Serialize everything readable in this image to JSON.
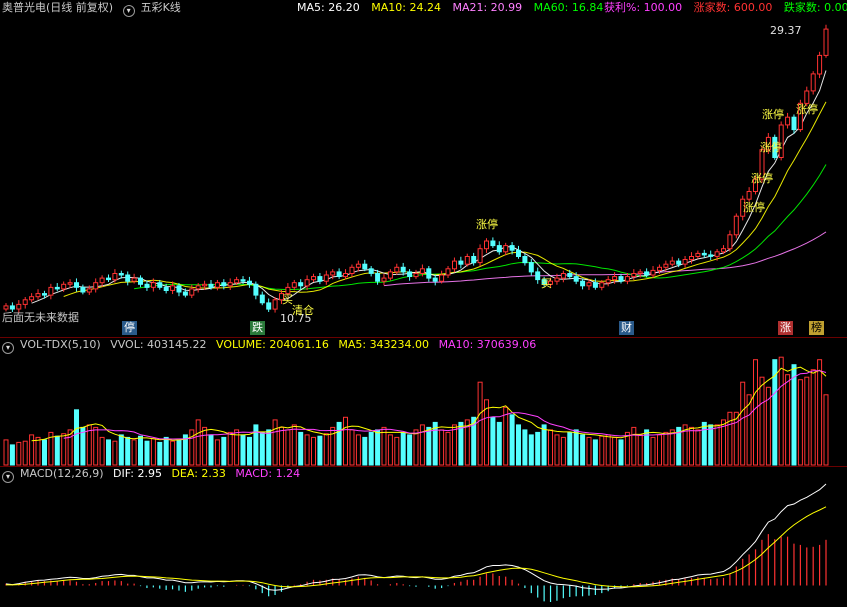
{
  "main_header": {
    "stock_name": "奥普光电",
    "period_info": "(日线 前复权)",
    "indicator_name": "五彩K线",
    "ma5_label": "MA5:",
    "ma5_value": "26.20",
    "ma10_label": "MA10:",
    "ma10_value": "24.24",
    "ma21_label": "MA21:",
    "ma21_value": "20.99",
    "ma60_label": "MA60:",
    "ma60_value": "16.84",
    "profit_label": "获利%:",
    "profit_value": "100.00",
    "up_label": "涨家数:",
    "up_value": "600.00",
    "down_label": "跌家数:",
    "down_value": "0.00"
  },
  "price_labels": {
    "high": "29.37",
    "low": "10.75"
  },
  "no_future_data": "后面无未来数据",
  "annotations": [
    {
      "text": "涨停",
      "color": "#ffff44"
    },
    {
      "text": "涨停",
      "color": "#ffff44"
    },
    {
      "text": "涨停",
      "color": "#ffff44"
    },
    {
      "text": "涨停",
      "color": "#ffff44"
    },
    {
      "text": "涨停",
      "color": "#ffff44"
    },
    {
      "text": "涨停",
      "color": "#ffff44"
    },
    {
      "text": "清仓",
      "color": "#ffff44"
    },
    {
      "text": "买",
      "color": "#ffff44"
    },
    {
      "text": "买",
      "color": "#ffff44"
    }
  ],
  "markers": [
    {
      "label": "停",
      "bg": "#2a5a8a",
      "color": "#ffffff"
    },
    {
      "label": "跌",
      "bg": "#2a7a3a",
      "color": "#ffffff"
    },
    {
      "label": "财",
      "bg": "#2a5a8a",
      "color": "#ffffff"
    },
    {
      "label": "涨",
      "bg": "#b03030",
      "color": "#ffffff"
    },
    {
      "label": "榜",
      "bg": "#c0a030",
      "color": "#000000"
    }
  ],
  "vol_header": {
    "name": "VOL-TDX(5,10)",
    "vvol_label": "VVOL:",
    "vvol_value": "403145.22",
    "volume_label": "VOLUME:",
    "volume_value": "204061.16",
    "ma5_label": "MA5:",
    "ma5_value": "343234.00",
    "ma10_label": "MA10:",
    "ma10_value": "370639.06"
  },
  "macd_header": {
    "name": "MACD(12,26,9)",
    "dif_label": "DIF:",
    "dif_value": "2.95",
    "dea_label": "DEA:",
    "dea_value": "2.33",
    "macd_label": "MACD:",
    "macd_value": "1.24"
  },
  "colors": {
    "up": "#ff3232",
    "down": "#54ffff",
    "ma5": "#ffffff",
    "ma10": "#ffff00",
    "ma21": "#ff80ff",
    "ma60": "#00ff00",
    "grid": "#6a0000",
    "profit": "#ff40ff",
    "up_count": "#ff3232",
    "down_count": "#00ff00"
  },
  "chart_data": {
    "type": "candlestick",
    "price_range": [
      10.75,
      29.37
    ],
    "close": [
      11.4,
      11.2,
      11.5,
      11.8,
      12.0,
      12.2,
      12.1,
      12.6,
      12.5,
      12.8,
      12.9,
      12.6,
      12.3,
      12.5,
      12.9,
      13.2,
      13.1,
      13.5,
      13.4,
      13.0,
      13.2,
      12.8,
      12.6,
      12.9,
      12.6,
      12.4,
      12.7,
      12.3,
      12.1,
      12.5,
      12.7,
      12.8,
      12.6,
      12.9,
      12.7,
      12.9,
      13.1,
      13.0,
      12.8,
      12.1,
      11.6,
      11.2,
      11.8,
      12.2,
      12.6,
      12.9,
      12.7,
      13.1,
      13.3,
      13.0,
      13.4,
      13.6,
      13.3,
      13.5,
      13.9,
      14.1,
      13.8,
      13.5,
      13.0,
      13.2,
      13.6,
      13.9,
      13.6,
      13.3,
      13.5,
      13.8,
      13.2,
      13.0,
      13.4,
      13.8,
      14.3,
      14.1,
      14.6,
      14.2,
      15.1,
      15.6,
      15.3,
      14.9,
      15.3,
      15.0,
      14.6,
      14.2,
      13.6,
      13.1,
      12.8,
      13.0,
      13.2,
      13.5,
      13.3,
      13.0,
      12.7,
      12.9,
      12.6,
      12.9,
      13.1,
      13.3,
      13.0,
      13.3,
      13.5,
      13.6,
      13.4,
      13.7,
      13.9,
      14.1,
      14.3,
      14.1,
      14.4,
      14.6,
      14.8,
      14.7,
      14.6,
      14.9,
      15.1,
      16.0,
      17.2,
      18.3,
      18.8,
      19.6,
      21.5,
      22.3,
      21.0,
      23.1,
      23.6,
      22.8,
      24.5,
      25.3,
      26.4,
      27.6,
      29.3
    ],
    "volume": [
      100,
      80,
      90,
      95,
      120,
      110,
      100,
      130,
      115,
      125,
      140,
      220,
      150,
      160,
      150,
      110,
      100,
      95,
      120,
      110,
      100,
      115,
      95,
      105,
      90,
      110,
      95,
      100,
      120,
      140,
      180,
      150,
      120,
      100,
      110,
      130,
      140,
      120,
      110,
      160,
      130,
      140,
      180,
      150,
      140,
      160,
      130,
      120,
      110,
      115,
      125,
      150,
      170,
      190,
      140,
      120,
      110,
      130,
      140,
      150,
      120,
      110,
      130,
      120,
      140,
      160,
      150,
      170,
      140,
      130,
      160,
      170,
      180,
      190,
      330,
      260,
      190,
      170,
      230,
      200,
      160,
      140,
      120,
      130,
      160,
      140,
      120,
      110,
      130,
      140,
      120,
      110,
      100,
      115,
      120,
      110,
      100,
      130,
      150,
      120,
      140,
      110,
      120,
      130,
      140,
      150,
      160,
      150,
      140,
      170,
      160,
      160,
      180,
      210,
      210,
      330,
      280,
      420,
      350,
      310,
      420,
      430,
      360,
      400,
      340,
      350,
      380,
      420,
      280
    ],
    "dif": [
      0.05,
      0.03,
      0.06,
      0.1,
      0.13,
      0.16,
      0.17,
      0.2,
      0.21,
      0.24,
      0.26,
      0.25,
      0.22,
      0.22,
      0.25,
      0.29,
      0.31,
      0.34,
      0.35,
      0.32,
      0.32,
      0.28,
      0.24,
      0.24,
      0.21,
      0.17,
      0.17,
      0.13,
      0.09,
      0.09,
      0.11,
      0.12,
      0.11,
      0.13,
      0.12,
      0.13,
      0.15,
      0.15,
      0.13,
      0.06,
      -0.03,
      -0.13,
      -0.15,
      -0.13,
      -0.08,
      -0.03,
      -0.01,
      0.04,
      0.09,
      0.1,
      0.14,
      0.19,
      0.2,
      0.22,
      0.27,
      0.33,
      0.34,
      0.32,
      0.27,
      0.25,
      0.27,
      0.3,
      0.29,
      0.26,
      0.25,
      0.27,
      0.24,
      0.2,
      0.2,
      0.23,
      0.29,
      0.32,
      0.38,
      0.4,
      0.49,
      0.59,
      0.63,
      0.63,
      0.65,
      0.63,
      0.58,
      0.5,
      0.39,
      0.27,
      0.15,
      0.08,
      0.04,
      0.03,
      0.01,
      -0.02,
      -0.07,
      -0.09,
      -0.12,
      -0.12,
      -0.11,
      -0.08,
      -0.08,
      -0.05,
      -0.02,
      0.01,
      0.02,
      0.05,
      0.09,
      0.13,
      0.18,
      0.2,
      0.24,
      0.28,
      0.33,
      0.35,
      0.36,
      0.4,
      0.44,
      0.56,
      0.75,
      0.97,
      1.17,
      1.39,
      1.71,
      2.0,
      2.1,
      2.33,
      2.52,
      2.57,
      2.69,
      2.78,
      2.9,
      3.02,
      3.2
    ],
    "dea": [
      0.02,
      0.02,
      0.03,
      0.04,
      0.06,
      0.08,
      0.1,
      0.12,
      0.14,
      0.16,
      0.18,
      0.19,
      0.2,
      0.2,
      0.21,
      0.22,
      0.24,
      0.26,
      0.28,
      0.29,
      0.29,
      0.29,
      0.28,
      0.27,
      0.26,
      0.24,
      0.23,
      0.21,
      0.19,
      0.17,
      0.16,
      0.15,
      0.14,
      0.14,
      0.14,
      0.13,
      0.14,
      0.14,
      0.14,
      0.12,
      0.09,
      0.04,
      0.0,
      -0.03,
      -0.04,
      -0.04,
      -0.03,
      -0.02,
      0.0,
      0.02,
      0.05,
      0.08,
      0.1,
      0.13,
      0.16,
      0.19,
      0.22,
      0.24,
      0.25,
      0.25,
      0.25,
      0.26,
      0.27,
      0.27,
      0.27,
      0.27,
      0.26,
      0.25,
      0.24,
      0.24,
      0.25,
      0.26,
      0.29,
      0.31,
      0.35,
      0.4,
      0.44,
      0.48,
      0.51,
      0.54,
      0.55,
      0.54,
      0.51,
      0.46,
      0.4,
      0.34,
      0.28,
      0.23,
      0.19,
      0.15,
      0.1,
      0.07,
      0.03,
      0.0,
      -0.02,
      -0.03,
      -0.04,
      -0.04,
      -0.04,
      -0.03,
      -0.02,
      -0.01,
      0.01,
      0.04,
      0.07,
      0.1,
      0.13,
      0.16,
      0.2,
      0.23,
      0.26,
      0.29,
      0.32,
      0.37,
      0.45,
      0.55,
      0.68,
      0.82,
      0.99,
      1.19,
      1.37,
      1.56,
      1.75,
      1.91,
      2.05,
      2.18,
      2.29,
      2.38,
      2.48
    ]
  }
}
